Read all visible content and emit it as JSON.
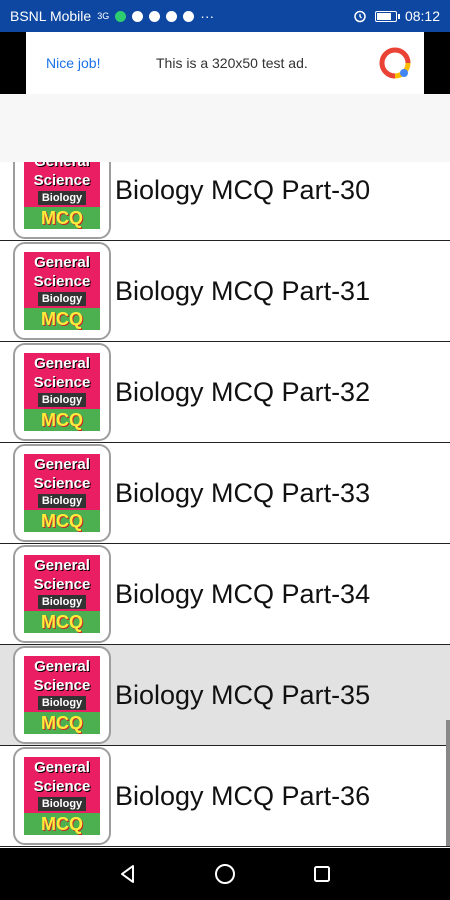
{
  "status_bar": {
    "carrier": "BSNL Mobile",
    "network": "3G",
    "time": "08:12",
    "more": "···"
  },
  "ad": {
    "left_text": "Nice job!",
    "main_text": "This is a 320x50 test ad.",
    "logo_icon": "ads-logo-icon"
  },
  "list": {
    "items": [
      {
        "title": "Biology MCQ Part-30",
        "thumb": {
          "line1": "General",
          "line2": "Science",
          "line3": "Biology",
          "line4": "MCQ"
        }
      },
      {
        "title": "Biology MCQ Part-31",
        "thumb": {
          "line1": "General",
          "line2": "Science",
          "line3": "Biology",
          "line4": "MCQ"
        }
      },
      {
        "title": "Biology MCQ Part-32",
        "thumb": {
          "line1": "General",
          "line2": "Science",
          "line3": "Biology",
          "line4": "MCQ"
        }
      },
      {
        "title": "Biology MCQ Part-33",
        "thumb": {
          "line1": "General",
          "line2": "Science",
          "line3": "Biology",
          "line4": "MCQ"
        }
      },
      {
        "title": "Biology MCQ Part-34",
        "thumb": {
          "line1": "General",
          "line2": "Science",
          "line3": "Biology",
          "line4": "MCQ"
        }
      },
      {
        "title": "Biology MCQ Part-35",
        "thumb": {
          "line1": "General",
          "line2": "Science",
          "line3": "Biology",
          "line4": "MCQ"
        }
      },
      {
        "title": "Biology MCQ Part-36",
        "thumb": {
          "line1": "General",
          "line2": "Science",
          "line3": "Biology",
          "line4": "MCQ"
        }
      }
    ],
    "selected_index": 5
  },
  "nav": {
    "back_icon": "back-triangle-icon",
    "home_icon": "home-circle-icon",
    "recents_icon": "recents-square-icon"
  },
  "colors": {
    "status_bar": "#0d47a1",
    "thumb_pink": "#e91e63",
    "thumb_green": "#4caf50",
    "thumb_yellow": "#ffeb3b",
    "selected_row": "#e2e2e2",
    "ad_link": "#1a73e8"
  }
}
